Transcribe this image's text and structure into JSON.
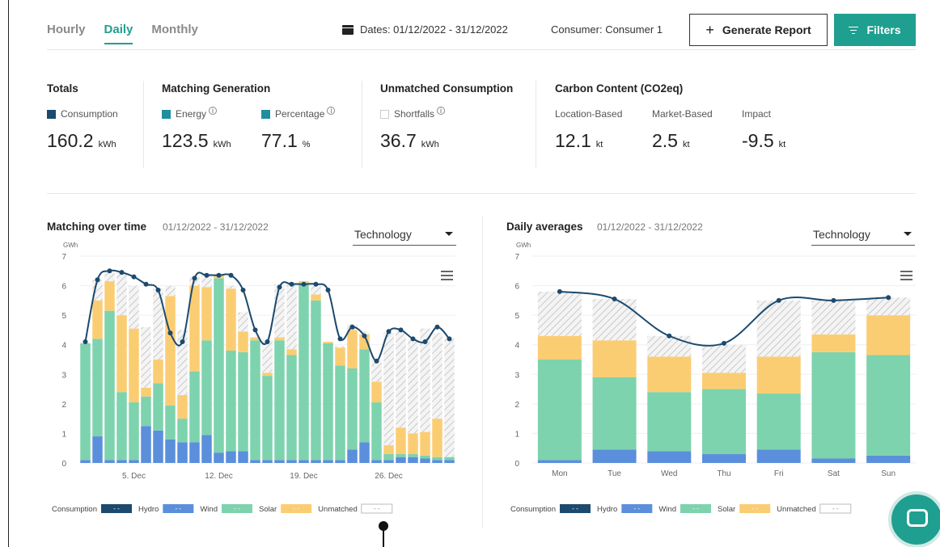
{
  "tabs": [
    {
      "label": "Hourly",
      "active": false
    },
    {
      "label": "Daily",
      "active": true
    },
    {
      "label": "Monthly",
      "active": false
    }
  ],
  "header": {
    "dates": "Dates: 01/12/2022 - 31/12/2022",
    "consumer": "Consumer:  Consumer 1",
    "report_button": "Generate Report",
    "filters_button": "Filters"
  },
  "kpis": {
    "totals": {
      "title": "Totals",
      "label": "Consumption",
      "value": "160.2",
      "unit": "kWh"
    },
    "matching": {
      "title": "Matching Generation",
      "energy_label": "Energy",
      "energy_value": "123.5",
      "energy_unit": "kWh",
      "pct_label": "Percentage",
      "pct_value": "77.1",
      "pct_unit": "%"
    },
    "unmatched": {
      "title": "Unmatched Consumption",
      "label": "Shortfalls",
      "value": "36.7",
      "unit": "kWh"
    },
    "carbon": {
      "title": "Carbon Content (CO2eq)",
      "loc_label": "Location-Based",
      "loc_value": "12.1",
      "loc_unit": "kt",
      "mkt_label": "Market-Based",
      "mkt_value": "2.5",
      "mkt_unit": "kt",
      "imp_label": "Impact",
      "imp_value": "-9.5",
      "imp_unit": "kt"
    }
  },
  "colors": {
    "accent": "#1f9f8f",
    "consumption": "#1c4a6e",
    "hydro": "#5b8fdc",
    "wind": "#7dd3ad",
    "solar": "#fbcd73",
    "unmatched_hatch": "#c9c9c9",
    "energy": "#1f8f9f",
    "percentage": "#1f8f9f"
  },
  "left_panel": {
    "title": "Matching over time",
    "range": "01/12/2022 - 31/12/2022",
    "select": "Technology"
  },
  "right_panel": {
    "title": "Daily averages",
    "range": "01/12/2022 - 31/12/2022",
    "select": "Technology"
  },
  "legend": [
    "Consumption",
    "Hydro",
    "Wind",
    "Solar",
    "Unmatched"
  ],
  "chart_data": [
    {
      "type": "bar",
      "stacked": true,
      "title": "Matching over time",
      "ylabel": "GWh",
      "ylim": [
        0,
        7
      ],
      "yticks": [
        0,
        1,
        2,
        3,
        4,
        5,
        6,
        7
      ],
      "xtick_labels": [
        "5. Dec",
        "12. Dec",
        "19. Dec",
        "26. Dec"
      ],
      "xtick_days": [
        5,
        12,
        19,
        26
      ],
      "x": [
        1,
        2,
        3,
        4,
        5,
        6,
        7,
        8,
        9,
        10,
        11,
        12,
        13,
        14,
        15,
        16,
        17,
        18,
        19,
        20,
        21,
        22,
        23,
        24,
        25,
        26,
        27,
        28,
        29,
        30,
        31
      ],
      "series": [
        {
          "name": "Hydro",
          "values": [
            0.1,
            0.9,
            0.1,
            0.1,
            0.1,
            1.25,
            1.1,
            0.8,
            0.7,
            0.7,
            0.95,
            0.35,
            0.4,
            0.4,
            0.1,
            0.1,
            0.1,
            0.1,
            0.1,
            0.1,
            0.1,
            0.1,
            0.45,
            0.7,
            0.1,
            0.1,
            0.2,
            0.2,
            0.15,
            0.1,
            0.1
          ]
        },
        {
          "name": "Wind",
          "values": [
            3.95,
            3.3,
            5.05,
            2.3,
            1.95,
            1.0,
            1.6,
            1.15,
            0.8,
            2.4,
            3.2,
            5.9,
            3.4,
            3.35,
            4.05,
            2.85,
            4.05,
            3.55,
            5.95,
            5.4,
            3.95,
            3.2,
            2.75,
            3.15,
            1.95,
            0.2,
            0.1,
            0.1,
            0.1,
            0.1,
            0.1
          ]
        },
        {
          "name": "Solar",
          "values": [
            0.0,
            1.3,
            1.0,
            2.6,
            2.5,
            0.3,
            0.8,
            3.7,
            0.8,
            2.9,
            1.8,
            0.1,
            2.1,
            0.7,
            0.1,
            0.1,
            0.1,
            0.2,
            0.1,
            0.2,
            0.05,
            0.6,
            1.3,
            0.5,
            0.7,
            0.3,
            0.9,
            0.7,
            0.8,
            1.3,
            0.0
          ]
        },
        {
          "name": "Unmatched",
          "values": [
            0.05,
            0.7,
            0.3,
            1.45,
            1.45,
            2.05,
            2.4,
            0.35,
            2.2,
            0.3,
            0.45,
            0.05,
            0.1,
            0.65,
            0.0,
            1.15,
            1.8,
            2.2,
            0.0,
            0.35,
            0.0,
            0.05,
            0.2,
            0.1,
            0.75,
            3.8,
            3.3,
            3.2,
            3.5,
            2.9,
            4.0
          ]
        }
      ],
      "consumption": [
        4.1,
        6.2,
        6.5,
        6.45,
        6.3,
        6.05,
        5.85,
        4.4,
        4.1,
        6.25,
        6.35,
        6.35,
        6.35,
        5.85,
        4.5,
        4.1,
        5.95,
        6.05,
        6.05,
        6.05,
        5.85,
        4.2,
        4.6,
        4.3,
        3.45,
        4.45,
        4.5,
        4.2,
        4.1,
        4.6,
        4.2
      ]
    },
    {
      "type": "bar",
      "stacked": true,
      "title": "Daily averages",
      "ylabel": "GWh",
      "ylim": [
        0,
        7
      ],
      "yticks": [
        0,
        1,
        2,
        3,
        4,
        5,
        6,
        7
      ],
      "categories": [
        "Mon",
        "Tue",
        "Wed",
        "Thu",
        "Fri",
        "Sat",
        "Sun"
      ],
      "series": [
        {
          "name": "Hydro",
          "values": [
            0.1,
            0.45,
            0.4,
            0.3,
            0.45,
            0.15,
            0.25
          ]
        },
        {
          "name": "Wind",
          "values": [
            3.4,
            2.45,
            2.0,
            2.2,
            1.9,
            3.6,
            3.4
          ]
        },
        {
          "name": "Solar",
          "values": [
            0.8,
            1.25,
            1.2,
            0.55,
            1.25,
            0.6,
            1.35
          ]
        },
        {
          "name": "Unmatched",
          "values": [
            1.5,
            1.4,
            0.7,
            0.95,
            1.9,
            1.15,
            0.6
          ]
        }
      ],
      "consumption": [
        5.8,
        5.55,
        4.3,
        4.05,
        5.5,
        5.5,
        5.6
      ]
    }
  ]
}
